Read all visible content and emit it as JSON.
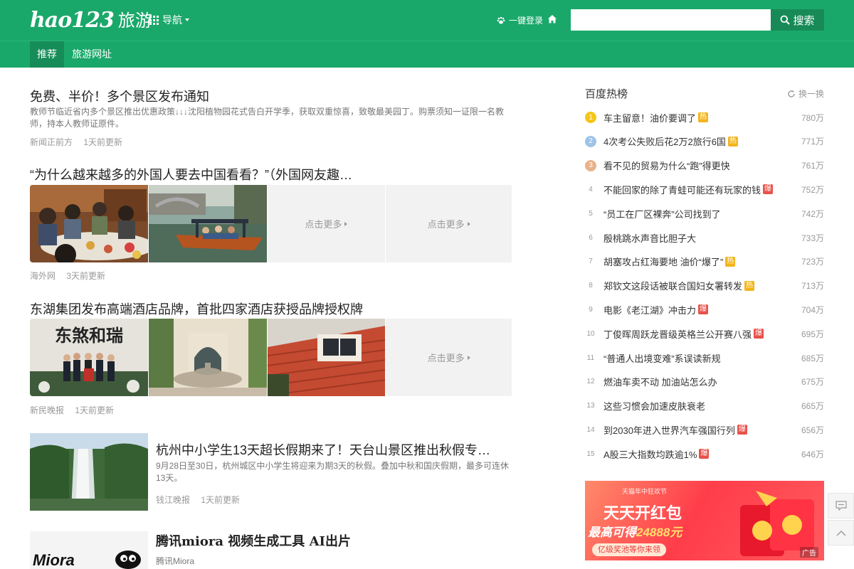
{
  "header": {
    "logo_mark": "hao123",
    "logo_text": "旅游",
    "nav_label": "导航",
    "login_label": "一键登录",
    "search_value": "",
    "search_button": "搜索"
  },
  "subnav": {
    "tabs": [
      {
        "label": "推荐"
      },
      {
        "label": "旅游网址"
      }
    ]
  },
  "feed": {
    "item1": {
      "title": "免费、半价！多个景区发布通知",
      "desc": "教师节临近省内多个景区推出优惠政策↓↓↓沈阳植物园花式告白开学季，获取双重惊喜，致敬最美园丁。购票须知一证限一名教师，持本人教师证原件。",
      "source": "新闻正前方",
      "time": "1天前更新"
    },
    "item2": {
      "title": "“为什么越来越多的外国人要去中国看看？”（外国网友趣…",
      "more1": "点击更多",
      "more2": "点击更多",
      "source": "海外网",
      "time": "3天前更新"
    },
    "item3": {
      "title": "东湖集团发布高端酒店品牌，首批四家酒店获授品牌授权牌",
      "banner_text": "东煞和瑞",
      "more": "点击更多",
      "source": "新民晚报",
      "time": "1天前更新"
    },
    "item4": {
      "title": "杭州中小学生13天超长假期来了！天台山景区推出秋假专…",
      "desc": "9月28日至30日，杭州城区中小学生将迎来为期3天的秋假。叠加中秋和国庆假期，最多可连休13天。",
      "source": "钱江晚报",
      "time": "1天前更新"
    },
    "item5": {
      "title": "腾讯miora 视频生成工具 AI出片",
      "thumb_text": "Miora",
      "source": "腾讯Miora"
    }
  },
  "hot": {
    "title": "百度热榜",
    "refresh": "换一换",
    "items": [
      {
        "rank": "1",
        "text": "车主留意！油价要调了",
        "badge": "热",
        "count": "780万"
      },
      {
        "rank": "2",
        "text": "4次考公失败后花2万2旅行6国",
        "badge": "热",
        "count": "771万"
      },
      {
        "rank": "3",
        "text": "看不见的贸易为什么“跑”得更快",
        "badge": "",
        "count": "761万"
      },
      {
        "rank": "4",
        "text": "不能回家的除了青蛙可能还有玩家的钱",
        "badge": "爆",
        "count": "752万"
      },
      {
        "rank": "5",
        "text": "“员工在厂区裸奔”公司找到了",
        "badge": "",
        "count": "742万"
      },
      {
        "rank": "6",
        "text": "殷桃跳水声音比胆子大",
        "badge": "",
        "count": "733万"
      },
      {
        "rank": "7",
        "text": "胡塞攻占红海要地 油价“爆了”",
        "badge": "热",
        "count": "723万"
      },
      {
        "rank": "8",
        "text": "郑钦文这段话被联合国妇女署转发",
        "badge": "热",
        "count": "713万"
      },
      {
        "rank": "9",
        "text": "电影《老江湖》冲击力",
        "badge": "爆",
        "count": "704万"
      },
      {
        "rank": "10",
        "text": "丁俊晖周跃龙晋级英格兰公开赛八强",
        "badge": "爆",
        "count": "695万"
      },
      {
        "rank": "11",
        "text": "“普通人出境变难”系误读新规",
        "badge": "",
        "count": "685万"
      },
      {
        "rank": "12",
        "text": "燃油车卖不动 加油站怎么办",
        "badge": "",
        "count": "675万"
      },
      {
        "rank": "13",
        "text": "这些习惯会加速皮肤衰老",
        "badge": "",
        "count": "665万"
      },
      {
        "rank": "14",
        "text": "到2030年进入世界汽车强国行列",
        "badge": "爆",
        "count": "656万"
      },
      {
        "rank": "15",
        "text": "A股三大指数均跌逾1%",
        "badge": "爆",
        "count": "646万"
      }
    ]
  },
  "ad": {
    "tag": "天猫年中狂欢节",
    "main": "天天开红包",
    "sub_prefix": "最高可得",
    "sub_amount": "24888元",
    "pill": "亿级奖池等你来领",
    "label": "广告"
  },
  "colors": {
    "brand": "#1aa86a",
    "brand_dark": "#168c58",
    "hot_badge": "#f3b51c",
    "boom_badge": "#e8514a"
  }
}
